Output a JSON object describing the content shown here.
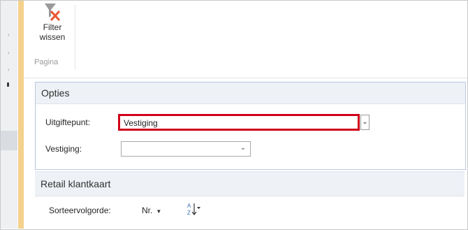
{
  "ribbon": {
    "filter_button_label": "Filter\nwissen",
    "group_label": "Pagina"
  },
  "options": {
    "title": "Opties",
    "uitgiftepunt_label": "Uitgiftepunt:",
    "uitgiftepunt_value": "Vestiging",
    "vestiging_label": "Vestiging:",
    "vestiging_value": ""
  },
  "section": {
    "title": "Retail klantkaart"
  },
  "sort": {
    "label": "Sorteervolgorde:",
    "value": "Nr."
  },
  "colors": {
    "highlight_border": "#d0021b",
    "left_accent": "#f4d18c",
    "panel_border": "#b8c9e0"
  }
}
